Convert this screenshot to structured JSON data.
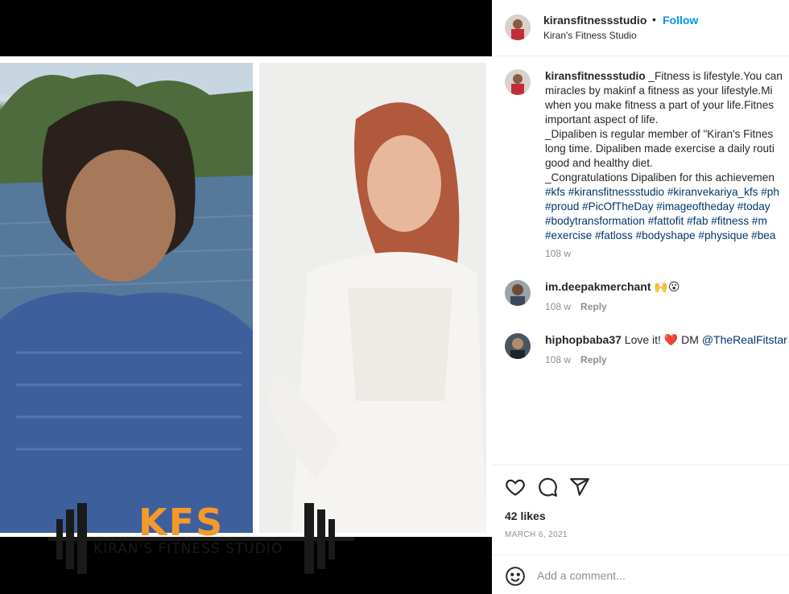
{
  "header": {
    "username": "kiransfitnessstudio",
    "separator": "•",
    "follow_label": "Follow",
    "subtitle": "Kiran's Fitness Studio"
  },
  "post_image": {
    "logo_text": "KFS",
    "logo_subtext": "KIRAN'S FITNESS STUDIO"
  },
  "caption": {
    "username": "kiransfitnessstudio",
    "lines": [
      " _Fitness is lifestyle.You can",
      "miracles by makinf a fitness as your lifestyle.Mi",
      "when you make fitness a part of your life.Fitnes",
      "important aspect of life.",
      "_Dipaliben is regular member of \"Kiran's Fitnes",
      "long time. Dipaliben made exercise a daily routi",
      "good and healthy diet.",
      "_Congratulations Dipaliben for this achievemen"
    ],
    "hashtag_lines": [
      "#kfs #kiransfitnessstudio #kiranvekariya_kfs #ph",
      "#proud #PicOfTheDay #imageoftheday #today",
      "#bodytransformation #fattofit #fab #fitness #m",
      "#exercise #fatloss #bodyshape #physique #bea"
    ],
    "time": "108 w"
  },
  "comments": [
    {
      "username": "im.deepakmerchant",
      "text": " 🙌😮",
      "mention": "",
      "time": "108 w",
      "reply_label": "Reply"
    },
    {
      "username": "hiphopbaba37",
      "text": " Love it! ❤️ DM ",
      "mention": "@TheRealFitstar",
      "time": "108 w",
      "reply_label": "Reply"
    }
  ],
  "actions": {
    "likes": "42 likes",
    "date": "MARCH 6, 2021"
  },
  "add_comment": {
    "placeholder": "Add a comment..."
  },
  "colors": {
    "follow": "#0095f6",
    "link": "#00376b",
    "muted": "#8e8e8e",
    "logo_orange": "#f39a2b"
  },
  "icons": [
    "heart-icon",
    "comment-icon",
    "share-icon",
    "emoji-icon"
  ]
}
